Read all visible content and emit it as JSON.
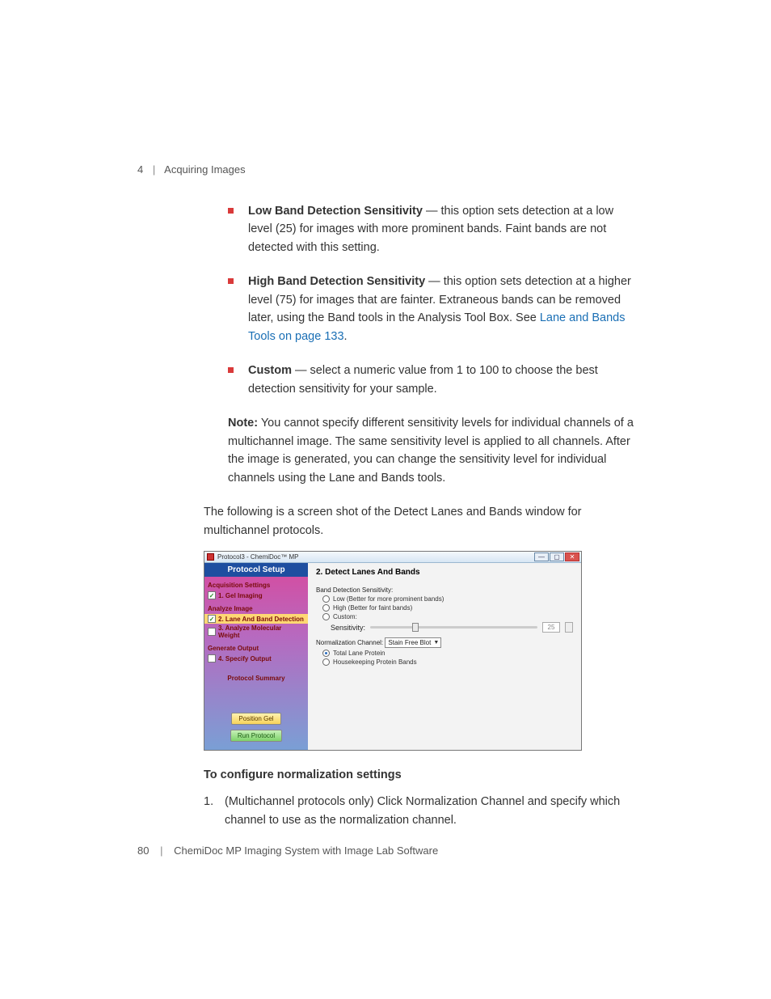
{
  "header": {
    "chapter_num": "4",
    "chapter_title": "Acquiring Images"
  },
  "bullets": {
    "low": {
      "title": "Low Band Detection Sensitivity",
      "text": " — this option sets detection at a low level (25) for images with more prominent bands. Faint bands are not detected with this setting."
    },
    "high": {
      "title": "High Band Detection Sensitivity",
      "text_a": " — this option sets detection at a higher level (75) for images that are fainter. Extraneous bands can be removed later, using the Band tools in the Analysis Tool Box. See ",
      "link": "Lane and Bands Tools on page 133",
      "text_b": "."
    },
    "custom": {
      "title": "Custom",
      "text": " — select a numeric value from 1 to 100 to choose the best detection sensitivity for your sample."
    }
  },
  "note_label": "Note:",
  "note_text": " You cannot specify different sensitivity levels for individual channels of a multichannel image. The same sensitivity level is applied to all channels. After the image is generated, you can change the sensitivity level for individual channels using the Lane and Bands tools.",
  "para_intro": "The following is a screen shot of the Detect Lanes and Bands window for multichannel protocols.",
  "subhead": "To configure normalization settings",
  "step1_num": "1.",
  "step1_text": "(Multichannel protocols only) Click Normalization Channel and specify which channel to use as the normalization channel.",
  "footer": {
    "page": "80",
    "product": "ChemiDoc MP Imaging System with Image Lab Software"
  },
  "shot": {
    "title": "Protocol3 - ChemiDoc™ MP",
    "sidebar_title": "Protocol Setup",
    "grp_acq": "Acquisition Settings",
    "item_gel": "1. Gel Imaging",
    "grp_analyze": "Analyze Image",
    "item_detect": "2. Lane And Band Detection",
    "item_mw": "3. Analyze Molecular Weight",
    "grp_output": "Generate Output",
    "item_output": "4. Specify Output",
    "summary": "Protocol Summary",
    "btn_position": "Position Gel",
    "btn_run": "Run Protocol",
    "main_head": "2. Detect Lanes And Bands",
    "sens_label": "Band Detection Sensitivity:",
    "opt_low": "Low (Better for more prominent bands)",
    "opt_high": "High (Better for faint bands)",
    "opt_custom": "Custom:",
    "sensitivity_label": "Sensitivity:",
    "sensitivity_value": "25",
    "norm_label": "Normalization Channel:",
    "norm_value": "Stain Free Blot",
    "norm_opt1": "Total Lane Protein",
    "norm_opt2": "Housekeeping Protein Bands"
  }
}
